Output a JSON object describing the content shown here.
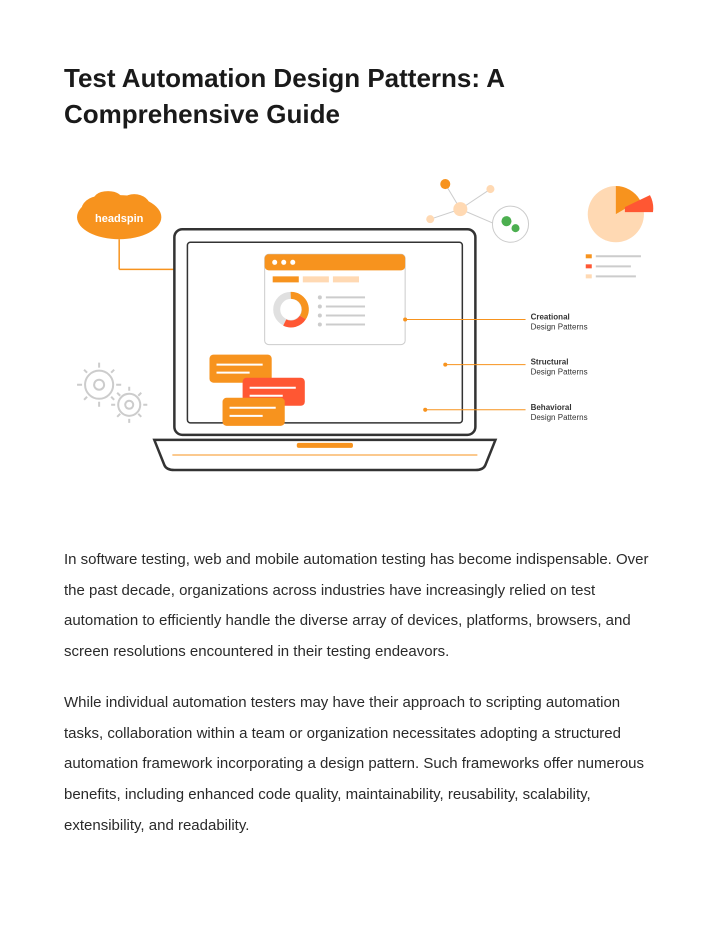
{
  "title": "Test Automation Design Patterns: A Comprehensive Guide",
  "illustration": {
    "cloud_label": "headspin",
    "pattern_labels": {
      "creational_bold": "Creational",
      "creational_rest": "Design Patterns",
      "structural_bold": "Structural",
      "structural_rest": "Design Patterns",
      "behavioral_bold": "Behavioral",
      "behavioral_rest": "Design Patterns"
    }
  },
  "paragraphs": {
    "p1": "In software testing, web and mobile automation testing has become indispensable. Over the past decade, organizations across industries have increasingly relied on test automation to efficiently handle the diverse array of devices, platforms, browsers, and screen resolutions encountered in their testing endeavors.",
    "p2": "While individual automation testers may have their approach to scripting automation tasks, collaboration within a team or organization necessitates adopting a structured automation framework incorporating a design pattern. Such frameworks offer numerous benefits, including enhanced code quality, maintainability, reusability, scalability, extensibility, and readability."
  }
}
